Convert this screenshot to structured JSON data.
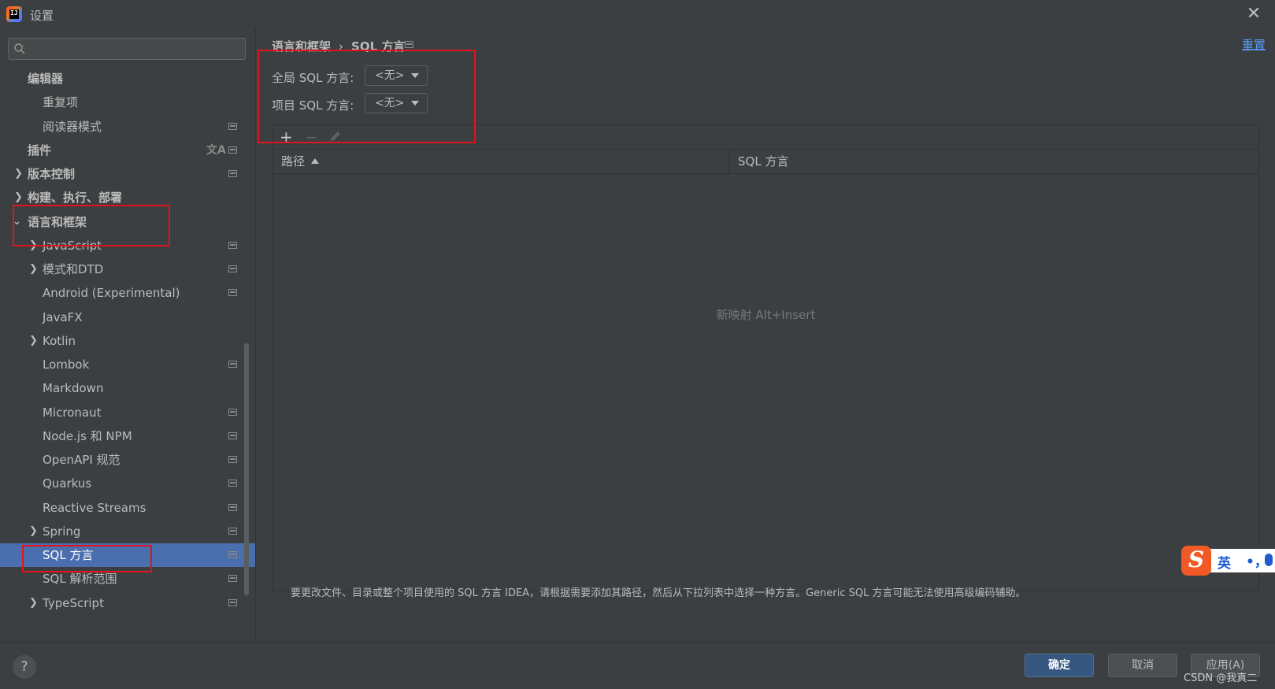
{
  "window": {
    "title": "设置"
  },
  "sidebar": {
    "search_placeholder": "",
    "items": [
      {
        "label": "编辑器"
      },
      {
        "label": "重复项"
      },
      {
        "label": "阅读器模式"
      },
      {
        "label": "插件"
      },
      {
        "label": "版本控制"
      },
      {
        "label": "构建、执行、部署"
      },
      {
        "label": "语言和框架"
      },
      {
        "label": "JavaScript"
      },
      {
        "label": "模式和DTD"
      },
      {
        "label": "Android (Experimental)"
      },
      {
        "label": "JavaFX"
      },
      {
        "label": "Kotlin"
      },
      {
        "label": "Lombok"
      },
      {
        "label": "Markdown"
      },
      {
        "label": "Micronaut"
      },
      {
        "label": "Node.js 和 NPM"
      },
      {
        "label": "OpenAPI 规范"
      },
      {
        "label": "Quarkus"
      },
      {
        "label": "Reactive Streams"
      },
      {
        "label": "Spring"
      },
      {
        "label": "SQL 方言"
      },
      {
        "label": "SQL 解析范围"
      },
      {
        "label": "TypeScript"
      }
    ]
  },
  "main": {
    "breadcrumb": {
      "parent": "语言和框架",
      "separator": "›",
      "current": "SQL 方言"
    },
    "reset_label": "重置",
    "global_dialect": {
      "label": "全局 SQL 方言:",
      "value": "<无>"
    },
    "project_dialect": {
      "label": "项目 SQL 方言:",
      "value": "<无>"
    },
    "toolbar": {
      "add": "+",
      "remove": "−"
    },
    "table": {
      "columns": [
        "路径",
        "SQL 方言"
      ],
      "empty_text": "新映射 Alt+Insert"
    },
    "hint": "要更改文件、目录或整个项目使用的 SQL 方言 IDEA，请根据需要添加其路径，然后从下拉列表中选择一种方言。Generic SQL 方言可能无法使用高级编码辅助。"
  },
  "footer": {
    "help": "?",
    "ok": "确定",
    "cancel": "取消",
    "apply": "应用(A)",
    "watermark": "CSDN @我真二"
  },
  "ime": {
    "lang": "英",
    "punct": "•，"
  },
  "colors": {
    "background": "#3c3f41",
    "selection": "#4b6eaf",
    "link": "#589df6",
    "ok_button": "#365880",
    "annotation": "#e0141c"
  }
}
